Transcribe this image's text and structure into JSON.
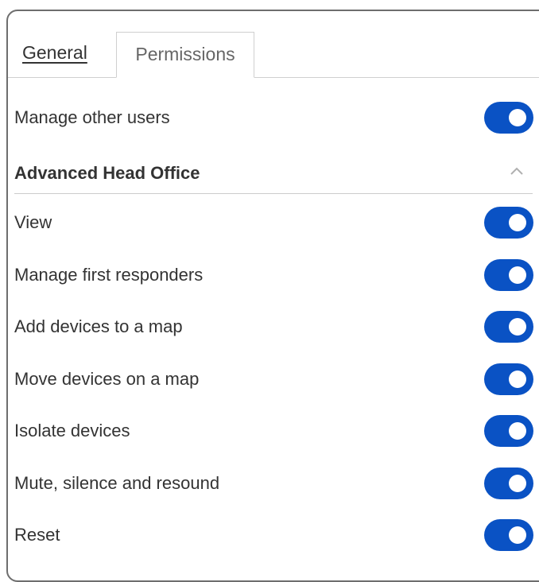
{
  "tabs": {
    "general": "General",
    "permissions": "Permissions",
    "active": "Permissions"
  },
  "top_permission": {
    "label": "Manage other users",
    "enabled": true
  },
  "section": {
    "title": "Advanced Head Office",
    "expanded": true,
    "chevron_icon": "chevron-up-icon"
  },
  "permissions": [
    {
      "label": "View",
      "enabled": true
    },
    {
      "label": "Manage first responders",
      "enabled": true
    },
    {
      "label": "Add devices to a map",
      "enabled": true
    },
    {
      "label": "Move devices on a map",
      "enabled": true
    },
    {
      "label": "Isolate devices",
      "enabled": true
    },
    {
      "label": "Mute, silence and resound",
      "enabled": true
    },
    {
      "label": "Reset",
      "enabled": true
    }
  ],
  "colors": {
    "toggle_on": "#0a52c4",
    "knob": "#ffffff",
    "border": "#6e6e6e",
    "text": "#333333"
  }
}
